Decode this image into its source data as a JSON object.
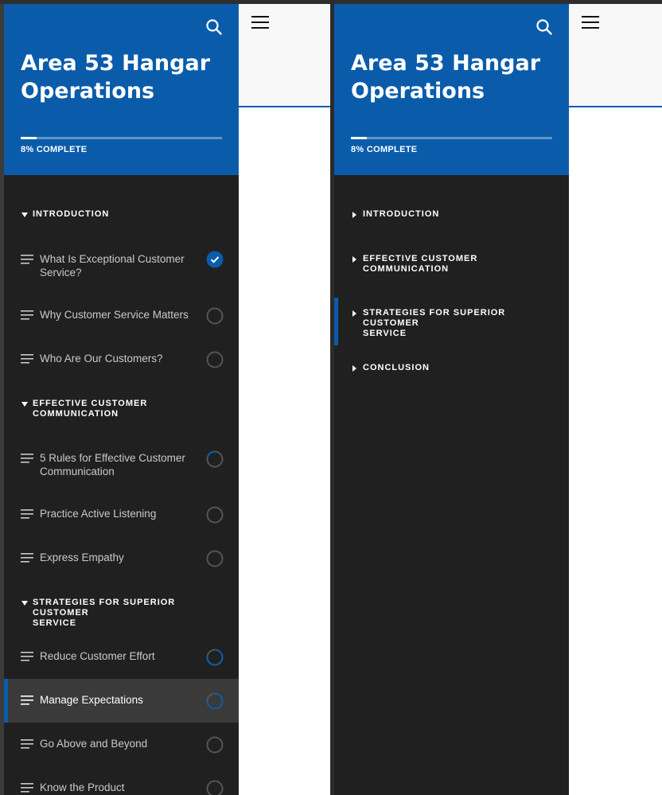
{
  "course": {
    "title_line1": "Area 53 Hangar",
    "title_line2": "Operations"
  },
  "progress": {
    "label": "8% COMPLETE",
    "percent": 8
  },
  "icons": {
    "search": "search-icon",
    "menu": "hamburger-menu-icon",
    "expanded": "caret-down-icon",
    "collapsed": "caret-right-icon",
    "lesson": "lesson-lines-icon",
    "complete": "check-circle-icon",
    "incomplete": "empty-circle-icon",
    "in_progress": "partial-circle-icon"
  },
  "colors": {
    "accent": "#0a5cab",
    "sidebar_bg": "#202020",
    "active_row": "#3a3a3a",
    "text": "#c9c9c9"
  },
  "left_pane": {
    "sections": [
      {
        "title_l1": "INTRODUCTION",
        "title_l2": "",
        "expanded": true
      },
      {
        "title_l1": "EFFECTIVE CUSTOMER",
        "title_l2": "COMMUNICATION",
        "expanded": true
      },
      {
        "title_l1": "STRATEGIES FOR SUPERIOR CUSTOMER",
        "title_l2": "SERVICE",
        "expanded": true
      }
    ],
    "lessons": [
      {
        "label_l1": "What Is Exceptional Customer",
        "label_l2": "Service?",
        "status": "complete"
      },
      {
        "label_l1": "Why Customer Service Matters",
        "label_l2": "",
        "status": "incomplete"
      },
      {
        "label_l1": "Who Are Our Customers?",
        "label_l2": "",
        "status": "incomplete"
      },
      {
        "label_l1": "5 Rules for Effective Customer",
        "label_l2": "Communication",
        "status": "in_progress"
      },
      {
        "label_l1": "Practice Active Listening",
        "label_l2": "",
        "status": "incomplete"
      },
      {
        "label_l1": "Express Empathy",
        "label_l2": "",
        "status": "incomplete"
      },
      {
        "label_l1": "Reduce Customer Effort",
        "label_l2": "",
        "status": "in_progress"
      },
      {
        "label_l1": "Manage Expectations",
        "label_l2": "",
        "status": "in_progress",
        "active": true
      },
      {
        "label_l1": "Go Above and Beyond",
        "label_l2": "",
        "status": "incomplete"
      },
      {
        "label_l1": "Know the Product",
        "label_l2": "",
        "status": "incomplete"
      }
    ]
  },
  "right_pane": {
    "sections": [
      {
        "title_l1": "INTRODUCTION",
        "title_l2": "",
        "expanded": false
      },
      {
        "title_l1": "EFFECTIVE CUSTOMER",
        "title_l2": "COMMUNICATION",
        "expanded": false
      },
      {
        "title_l1": "STRATEGIES FOR SUPERIOR CUSTOMER",
        "title_l2": "SERVICE",
        "expanded": false,
        "active": true
      },
      {
        "title_l1": "CONCLUSION",
        "title_l2": "",
        "expanded": false
      }
    ]
  }
}
